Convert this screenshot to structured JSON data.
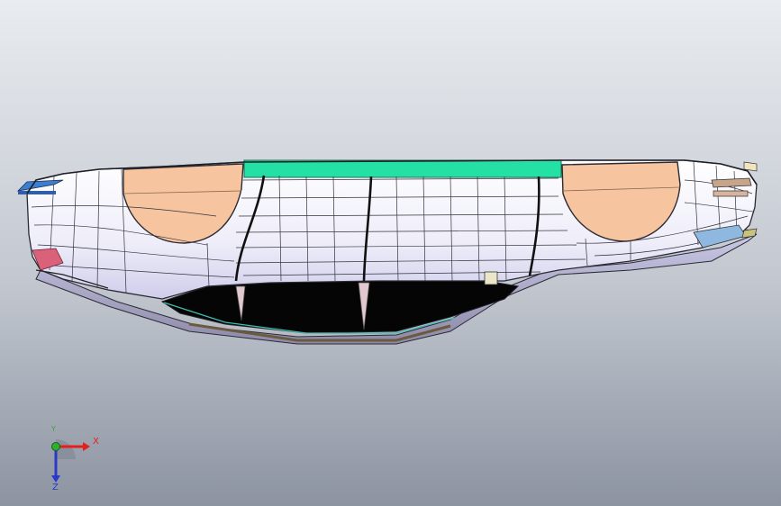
{
  "viewport": {
    "background_top": "#e7eaee",
    "background_bottom": "#8f96a4",
    "colors": {
      "body_fill": "#f3f2fb",
      "mesh_line": "#2f2f3a",
      "wheel_arch": "#f6c49e",
      "roof_strip": "#25e0a5",
      "underbody": "#050505",
      "accent_blue": "#3b7fd0",
      "accent_red": "#d9627a",
      "trim_bronze": "#6b5a3e"
    }
  },
  "triad": {
    "x_label": "X",
    "y_label": "Y",
    "z_label": "Z",
    "x_color": "#e3201b",
    "y_color": "#2fb02f",
    "z_color": "#2a39c9"
  }
}
